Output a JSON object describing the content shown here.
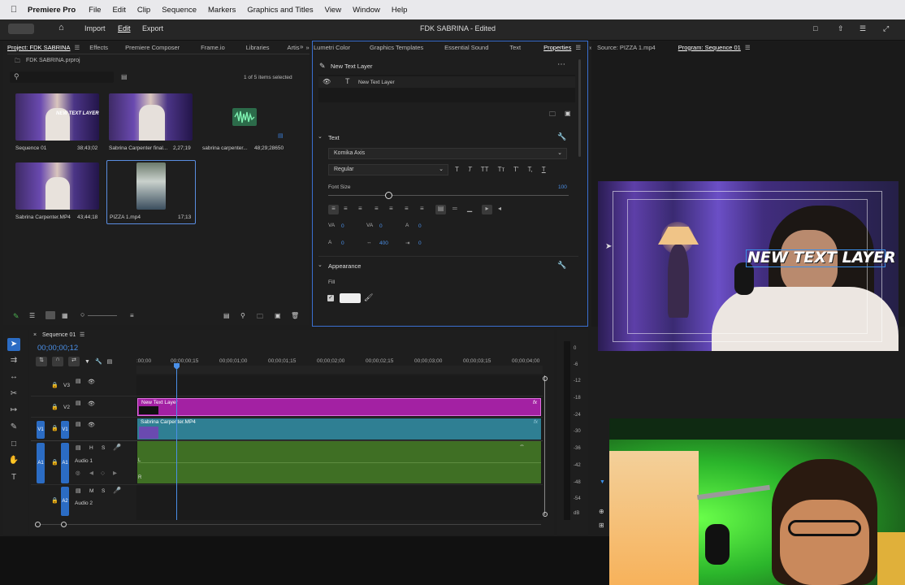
{
  "menubar": {
    "apple": "",
    "app": "Premiere Pro",
    "items": [
      "File",
      "Edit",
      "Clip",
      "Sequence",
      "Markers",
      "Graphics and Titles",
      "View",
      "Window",
      "Help"
    ]
  },
  "titlebar": {
    "import": "Import",
    "edit": "Edit",
    "export": "Export",
    "title": "FDK SABRINA - Edited"
  },
  "project": {
    "tabs": [
      "Project: FDK SABRINA",
      "Effects",
      "Premiere Composer",
      "Frame.io",
      "Libraries",
      "Artis"
    ],
    "file": "FDK SABRINA.prproj",
    "selection": "1 of 5 items selected",
    "items": [
      {
        "name": "Sequence 01",
        "dur": "38;43;02"
      },
      {
        "name": "Sabrina Carpenter final...",
        "dur": "2,27;19"
      },
      {
        "name": "sabrina carpenter...",
        "dur": "48;29;28650"
      },
      {
        "name": "Sabrina Carpenter.MP4",
        "dur": "43;44;18"
      },
      {
        "name": "PIZZA 1.mp4",
        "dur": "17;13"
      }
    ],
    "thumb_text": "NEW TEXT LAYER"
  },
  "props": {
    "tabs": [
      "Lumetri Color",
      "Graphics Templates",
      "Essential Sound",
      "Text",
      "Properties"
    ],
    "layer_title": "New Text Layer",
    "layer_item": "New Text Layer",
    "text_section": "Text",
    "font": "Komika Axis",
    "style": "Regular",
    "style_buttons": [
      "T",
      "T",
      "TT",
      "Tт",
      "T'",
      "T,",
      "T"
    ],
    "font_size_label": "Font Size",
    "font_size": "100",
    "metrics": [
      "0",
      "0",
      "0",
      "0",
      "400",
      "0"
    ],
    "appearance": "Appearance",
    "fill": "Fill"
  },
  "program": {
    "source_tab": "Source: PIZZA 1.mp4",
    "program_tab": "Program: Sequence 01",
    "overlay_text": "NEW TEXT LAYER"
  },
  "timeline": {
    "tab": "Sequence 01",
    "timecode": "00;00;00;12",
    "ruler": [
      ":00;00",
      "00;00;00;15",
      "00;00;01;00",
      "00;00;01;15",
      "00;00;02;00",
      "00;00;02;15",
      "00;00;03;00",
      "00;00;03;15",
      "00;00;04;00"
    ],
    "tracks": {
      "v3": "V3",
      "v2": "V2",
      "v1": "V1",
      "v1b": "V1",
      "a1": "A1",
      "a1b": "A1",
      "a2": "A2",
      "audio1": "Audio 1",
      "audio2": "Audio 2"
    },
    "clips": {
      "text": "New Text Layer",
      "video": "Sabrina Carpenter.MP4"
    },
    "audio_ch": [
      "L",
      "R"
    ],
    "solo": "S",
    "mute": "M",
    "hide": "H"
  },
  "meters": [
    "0",
    "-6",
    "-12",
    "-18",
    "-24",
    "-30",
    "-36",
    "-42",
    "-48",
    "-54",
    "dB"
  ],
  "colors": {
    "accent": "#2b6cc4",
    "text_clip": "#a321a3",
    "video_clip": "#2f7f93",
    "audio_clip": "#3f6f24"
  }
}
